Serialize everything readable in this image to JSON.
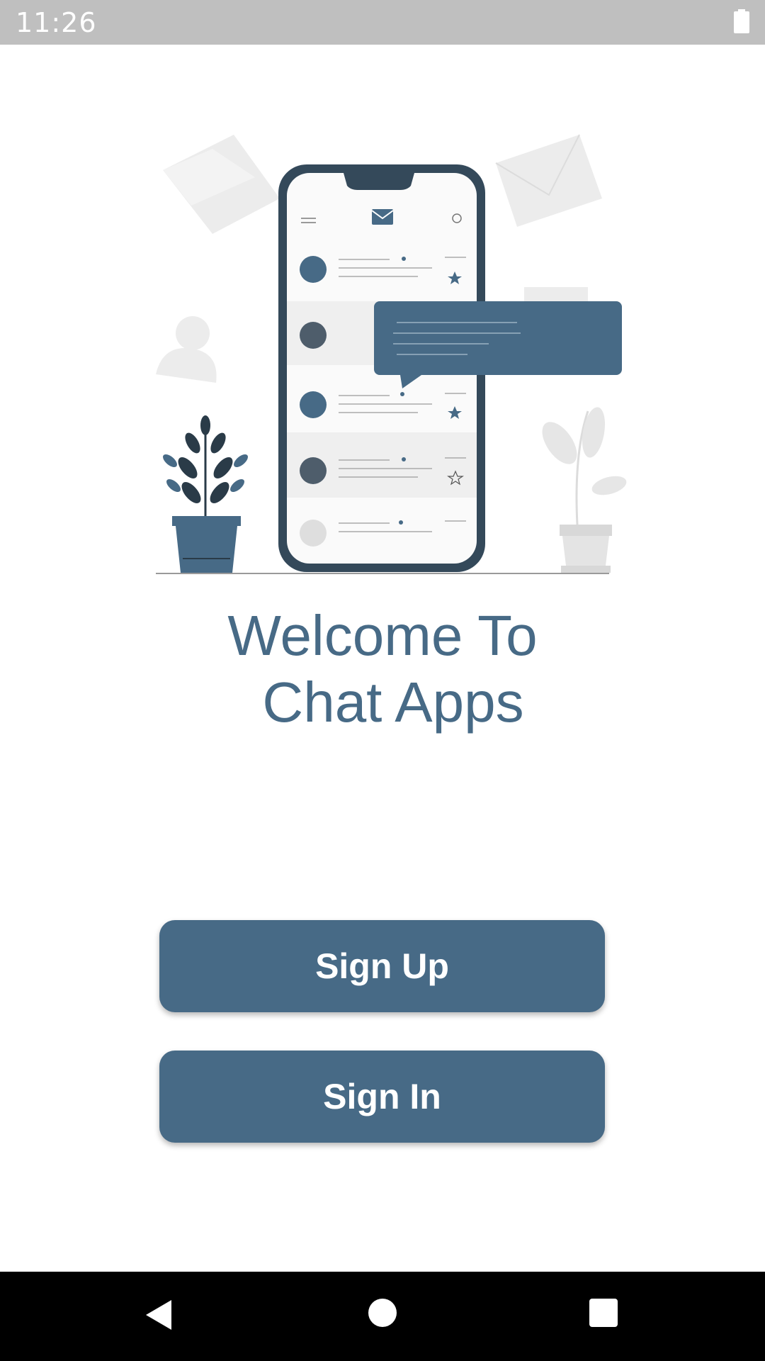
{
  "status_bar": {
    "time": "11:26",
    "battery_icon": "battery-full-icon"
  },
  "welcome": {
    "line1": "Welcome To",
    "line2": "Chat Apps"
  },
  "buttons": {
    "sign_up": "Sign Up",
    "sign_in": "Sign In"
  },
  "nav_bar": {
    "back_icon": "back-triangle-icon",
    "home_icon": "home-circle-icon",
    "recents_icon": "recents-square-icon"
  },
  "colors": {
    "accent": "#476a86",
    "status_bar": "#bfbfbf",
    "nav_bar": "#000000",
    "background": "#ffffff"
  }
}
